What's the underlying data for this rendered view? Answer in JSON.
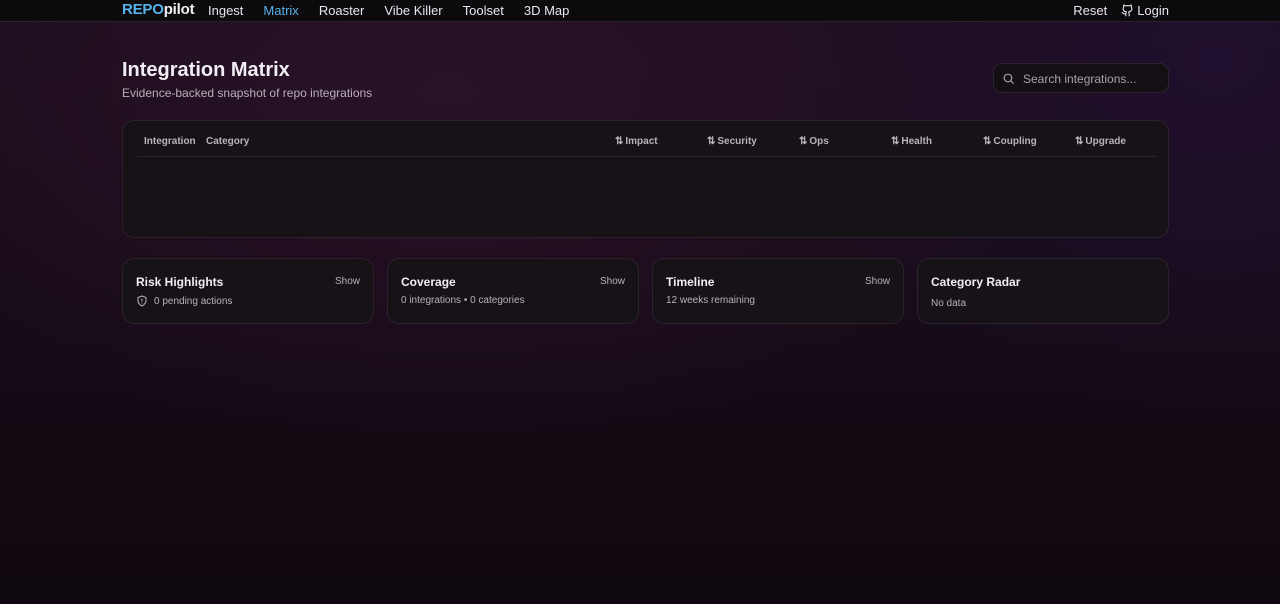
{
  "nav": {
    "brand_part1": "REPO",
    "brand_part2": "pilot",
    "links": [
      "Ingest",
      "Matrix",
      "Roaster",
      "Vibe Killer",
      "Toolset",
      "3D Map"
    ],
    "active": "Matrix",
    "reset": "Reset",
    "login": "Login"
  },
  "page": {
    "title": "Integration Matrix",
    "subtitle": "Evidence-backed snapshot of repo integrations"
  },
  "search": {
    "placeholder": "Search integrations...",
    "value": ""
  },
  "table": {
    "columns": [
      {
        "label": "Integration",
        "sortable": false
      },
      {
        "label": "Category",
        "sortable": false
      },
      {
        "label": "Impact",
        "sortable": true
      },
      {
        "label": "Security",
        "sortable": true
      },
      {
        "label": "Ops",
        "sortable": true
      },
      {
        "label": "Health",
        "sortable": true
      },
      {
        "label": "Coupling",
        "sortable": true
      },
      {
        "label": "Upgrade",
        "sortable": true
      }
    ],
    "rows": []
  },
  "cards": {
    "risk": {
      "title": "Risk Highlights",
      "show": "Show",
      "subtitle": "0 pending actions",
      "icon": "shield-icon"
    },
    "coverage": {
      "title": "Coverage",
      "show": "Show",
      "subtitle": "0 integrations • 0 categories"
    },
    "timeline": {
      "title": "Timeline",
      "show": "Show",
      "subtitle": "12 weeks remaining"
    },
    "radar": {
      "title": "Category Radar",
      "subtitle": "No data"
    }
  },
  "colors": {
    "accent": "#56b3ea",
    "background": "#1b0d1c",
    "card": "#161217",
    "border": "#2a232b"
  }
}
